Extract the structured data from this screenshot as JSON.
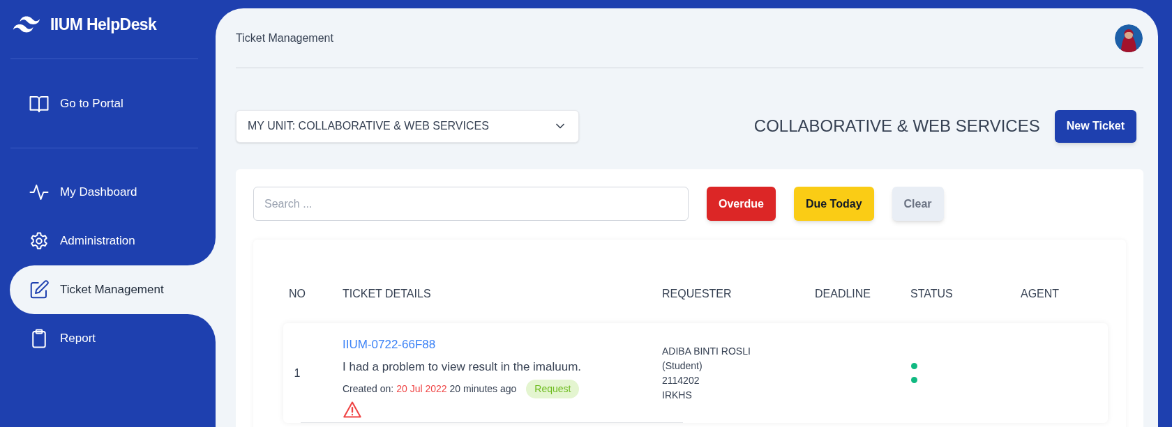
{
  "sidebar": {
    "brand": "IIUM HelpDesk",
    "portal_link": {
      "label": "Go to Portal"
    },
    "items": [
      {
        "label": "My Dashboard",
        "selected": false
      },
      {
        "label": "Administration",
        "selected": false
      },
      {
        "label": "Ticket Management",
        "selected": true
      },
      {
        "label": "Report",
        "selected": false
      }
    ]
  },
  "header": {
    "title": "Ticket Management"
  },
  "unit_select": {
    "value": "MY UNIT: COLLABORATIVE & WEB SERVICES"
  },
  "unit_heading": "COLLABORATIVE & WEB SERVICES",
  "new_ticket_button": "New Ticket",
  "filters": {
    "search": {
      "placeholder": "Search ..."
    },
    "buttons": [
      {
        "label": "Overdue",
        "kind": "danger"
      },
      {
        "label": "Due Today",
        "kind": "warning"
      },
      {
        "label": "Clear",
        "kind": "neutral"
      }
    ]
  },
  "table": {
    "columns": [
      "NO",
      "TICKET DETAILS",
      "REQUESTER",
      "DEADLINE",
      "STATUS",
      "AGENT"
    ],
    "rows": [
      {
        "no": "1",
        "ticket_id": "IIUM-0722-66F88",
        "subject": "I had a problem to view result in the imaluum.",
        "created_label": "Created on:",
        "created_date": "20 Jul 2022",
        "created_ago": "20 minutes ago",
        "category": "Request",
        "overdue_warning": true,
        "requester": [
          "ADIBA BINTI ROSLI",
          "(Student)",
          "2114202",
          "IRKHS"
        ],
        "status": [
          {
            "color": "#10b981"
          },
          {
            "color": "#10b981"
          }
        ]
      }
    ]
  }
}
